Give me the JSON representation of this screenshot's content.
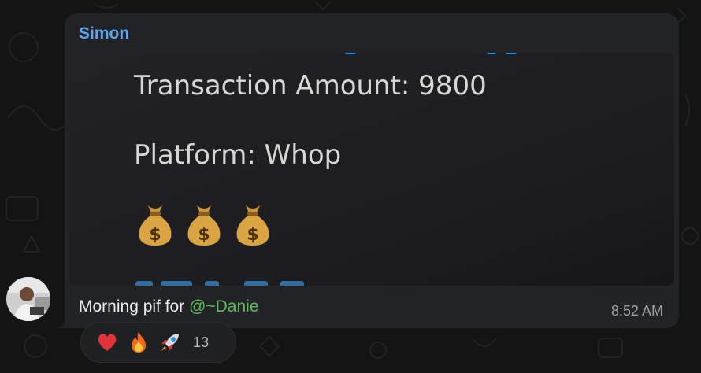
{
  "message": {
    "sender": "Simon",
    "media": {
      "line1": "Transaction Amount: 9800",
      "line2": "Platform: Whop",
      "emoji": [
        "money-bag",
        "money-bag",
        "money-bag"
      ]
    },
    "caption_prefix": "Morning pif for ",
    "mention": "@~Danie",
    "time": "8:52 AM"
  },
  "reactions": {
    "items": [
      "red-heart",
      "fire",
      "rocket"
    ],
    "count": "13"
  },
  "colors": {
    "sender": "#5fa5ec",
    "mention": "#5fb85c",
    "bubble": "#222326",
    "background": "#141414"
  }
}
